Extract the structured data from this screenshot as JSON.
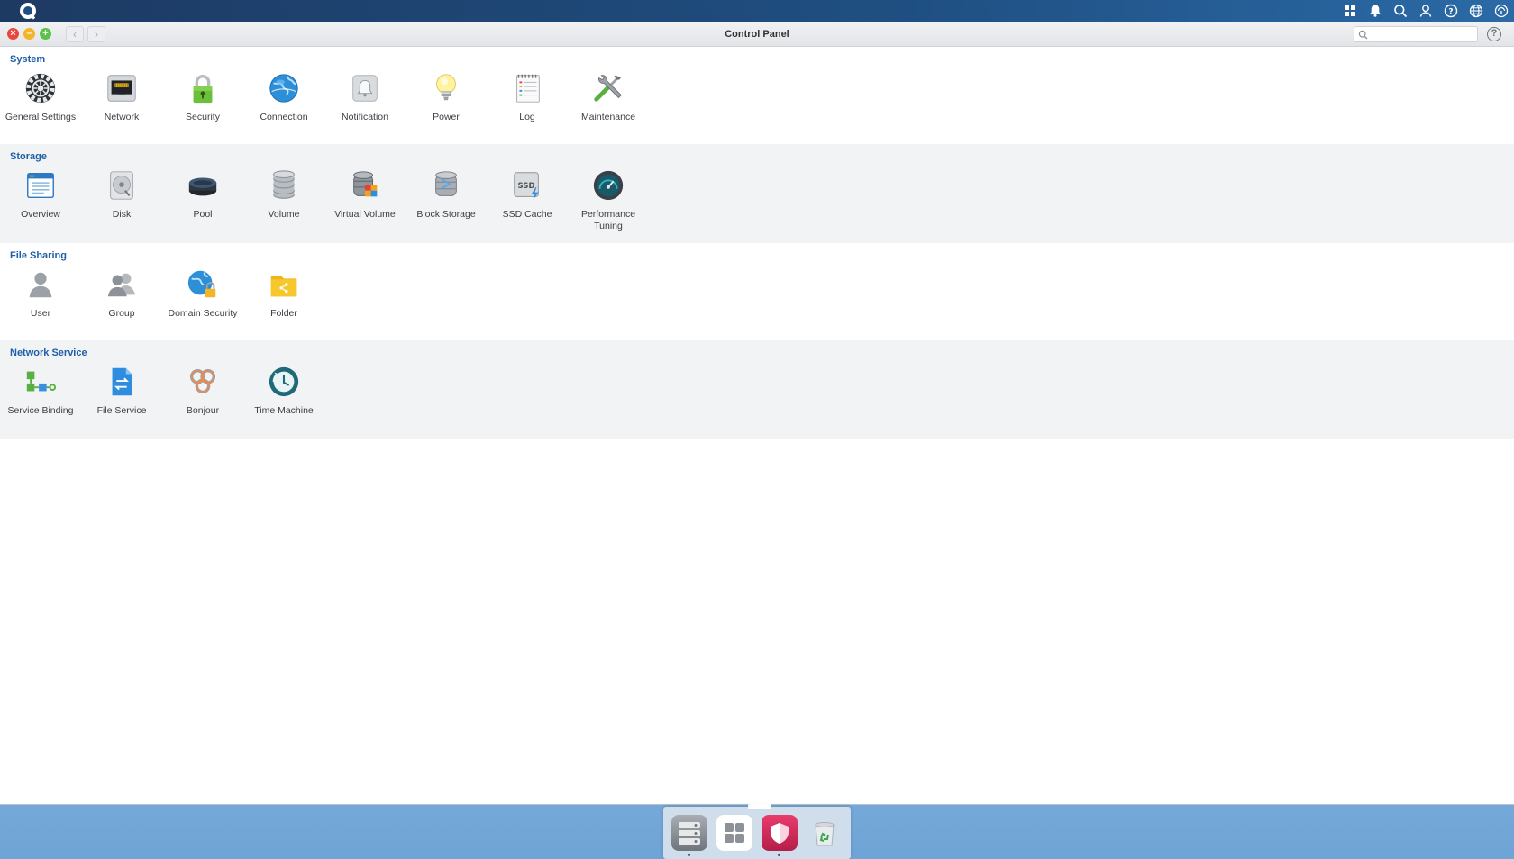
{
  "window": {
    "title": "Control Panel"
  },
  "search": {
    "placeholder": ""
  },
  "titlebar": {
    "back": "‹",
    "forward": "›",
    "help": "?"
  },
  "sections": [
    {
      "title": "System",
      "items": [
        {
          "label": "General Settings",
          "icon": "gear-icon"
        },
        {
          "label": "Network",
          "icon": "network-port-icon"
        },
        {
          "label": "Security",
          "icon": "padlock-icon"
        },
        {
          "label": "Connection",
          "icon": "globe-icon"
        },
        {
          "label": "Notification",
          "icon": "bell-icon"
        },
        {
          "label": "Power",
          "icon": "lightbulb-icon"
        },
        {
          "label": "Log",
          "icon": "log-notebook-icon"
        },
        {
          "label": "Maintenance",
          "icon": "tools-icon"
        }
      ]
    },
    {
      "title": "Storage",
      "items": [
        {
          "label": "Overview",
          "icon": "overview-window-icon"
        },
        {
          "label": "Disk",
          "icon": "disk-icon"
        },
        {
          "label": "Pool",
          "icon": "pool-icon"
        },
        {
          "label": "Volume",
          "icon": "volume-stack-icon"
        },
        {
          "label": "Virtual Volume",
          "icon": "virtual-volume-icon"
        },
        {
          "label": "Block Storage",
          "icon": "block-storage-icon"
        },
        {
          "label": "SSD Cache",
          "icon": "ssd-cache-icon",
          "badge": "SSD"
        },
        {
          "label": "Performance Tuning",
          "icon": "gauge-icon"
        }
      ]
    },
    {
      "title": "File Sharing",
      "items": [
        {
          "label": "User",
          "icon": "user-icon"
        },
        {
          "label": "Group",
          "icon": "group-icon"
        },
        {
          "label": "Domain Security",
          "icon": "domain-security-icon"
        },
        {
          "label": "Folder",
          "icon": "shared-folder-icon"
        }
      ]
    },
    {
      "title": "Network Service",
      "items": [
        {
          "label": "Service Binding",
          "icon": "service-binding-icon"
        },
        {
          "label": "File Service",
          "icon": "file-service-icon"
        },
        {
          "label": "Bonjour",
          "icon": "bonjour-icon"
        },
        {
          "label": "Time Machine",
          "icon": "time-machine-icon"
        }
      ]
    }
  ],
  "tray": [
    "apps-grid-icon",
    "bell-icon",
    "search-icon",
    "user-icon",
    "help-icon",
    "globe-icon",
    "info-icon"
  ],
  "dock": [
    "storage-manager-icon",
    "app-grid-icon",
    "security-shield-icon",
    "recycle-bin-icon"
  ],
  "colors": {
    "accent": "#1d5fa8",
    "topbar": "#1f4f82"
  }
}
